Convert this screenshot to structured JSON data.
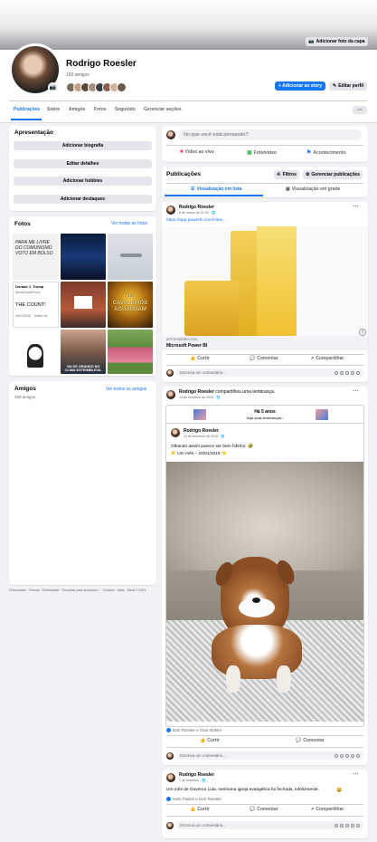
{
  "cover": {
    "add_cover_label": "Adicionar foto da capa"
  },
  "profile": {
    "name": "Rodrigo Roesler",
    "friends_count": "160 amigos"
  },
  "header_actions": {
    "add_story": "+ Adicionar ao story",
    "edit_profile": "Editar perfil"
  },
  "tabs": [
    {
      "label": "Publicações"
    },
    {
      "label": "Sobre"
    },
    {
      "label": "Amigos"
    },
    {
      "label": "Fotos"
    },
    {
      "label": "Seguindo"
    },
    {
      "label": "Gerenciar seções"
    }
  ],
  "more_label": "···",
  "intro": {
    "title": "Apresentação",
    "buttons": [
      "Adicionar biografia",
      "Editar detalhes",
      "Adicionar hobbies",
      "Adicionar destaques"
    ]
  },
  "photos": {
    "title": "Fotos",
    "see_all": "Ver todas as fotos",
    "captions": {
      "p1": "PARA ME LIVRE DO COMUNISMO VOTO EM BOLSO",
      "p4_name": "Donald J. Trump",
      "p4_handle": "@realDonaldTrump",
      "p4_text": "THE COUNT!",
      "p4_date": "05/11/2020 · Twitter for",
      "p6": "OS CAVALEIROS AGUARDAM",
      "p8": "VAI SE ORANDO NO CLIMA ESTRIMBLEVIL"
    }
  },
  "friends_section": {
    "title": "Amigos",
    "count": "160 amigos",
    "see_all": "Ver todos os amigos"
  },
  "footer": "Privacidade · Termos · Publicidade · Escolhas para anúncios ▷ · Cookies · Mais · Meta © 2023",
  "composer": {
    "placeholder": "No que você está pensando?",
    "live": "Vídeo ao vivo",
    "photo": "Foto/vídeo",
    "event": "Acontecimento"
  },
  "posts_header": {
    "title": "Publicações",
    "filters": "Filtros",
    "manage": "Gerenciar publicações",
    "list_view": "Visualização em lista",
    "grid_view": "Visualização em grade"
  },
  "post1": {
    "author": "Rodrigo Roesler",
    "time": "6 de março às 07:03 · 🌐",
    "text": "https://app.powerbi.com/view...",
    "link_domain": "APP.POWERBI.COM",
    "link_title": "Microsoft Power BI"
  },
  "post2": {
    "author": "Rodrigo Roesler",
    "action": " compartilhou uma lembrança.",
    "time": "14 de fevereiro de 2018 · 🌐",
    "memory_title": "Há 5 anos",
    "memory_sub": "Veja suas lembranças ›",
    "inner_author": "Rodrigo Roesler",
    "inner_time": "24 de fevereiro de 2018 · 🌐",
    "inner_text": "Olhando assim parece ser bem fofinho. 🤣",
    "inner_text2": "👉 Um mês – 24/01/2018 👈",
    "reactions": "Dari Roesler e Clair Mahler"
  },
  "post3": {
    "author": "Rodrigo Roesler",
    "time": "7 de fevereiro · 🌐",
    "text": "Um mês de Governo Lula, nenhuma igreja evangélica foi fechada, infelizmente.",
    "emoji": "😄",
    "reactions": "Ivelo Faistel e Dari Roesler"
  },
  "actions": {
    "like": "Curtir",
    "comment": "Comentar",
    "share": "Compartilhar"
  },
  "comment_placeholder": "Escreva um comentário...",
  "colors": {
    "accent": "#1877f2",
    "bg": "#f0f2f5"
  }
}
